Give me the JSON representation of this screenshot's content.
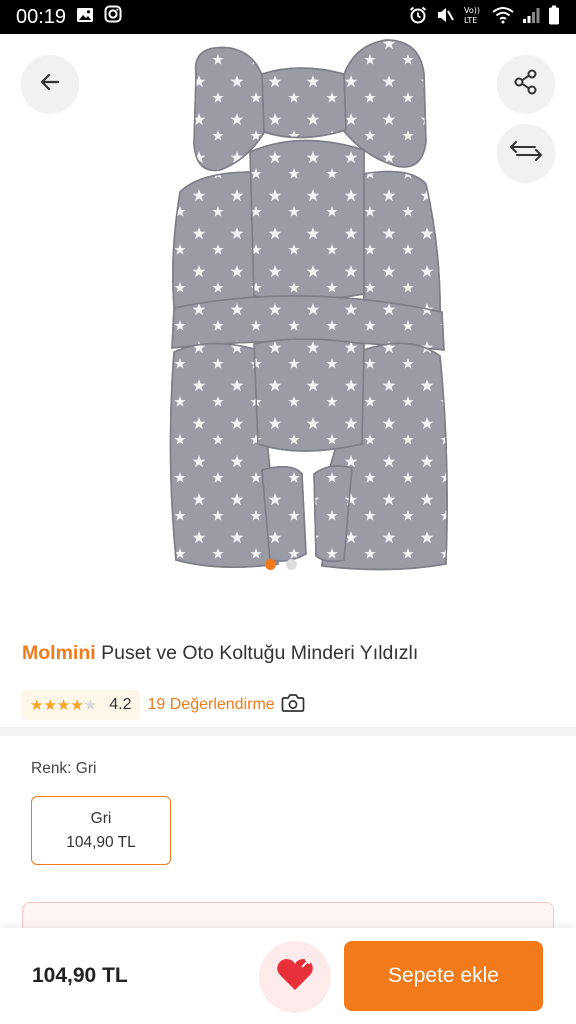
{
  "status_bar": {
    "time": "00:19",
    "left_icons": [
      "gallery-icon",
      "instagram-icon"
    ],
    "right_icons": [
      "alarm-icon",
      "mute-icon",
      "volte-icon",
      "wifi-icon",
      "signal-icon",
      "battery-icon"
    ],
    "volte_text": "Vo)) LTE"
  },
  "product": {
    "brand": "Molmini",
    "name": "Puset ve Oto Koltuğu Minderi Yıldızlı",
    "rating": "4.2",
    "rating_fraction": 0.84,
    "stars_glyph": "★★★★★",
    "reviews_label": "19 Değerlendirme",
    "image_count": 2,
    "active_image": 0
  },
  "variant": {
    "label": "Renk: Gri",
    "selected_name": "Gri",
    "selected_price": "104,90 TL"
  },
  "bottom": {
    "price": "104,90 TL",
    "add_to_cart_label": "Sepete ekle"
  },
  "colors": {
    "accent": "#f27a1a",
    "star": "#f6a623",
    "fav_bg": "#fdeaea",
    "heart": "#e8303a"
  }
}
